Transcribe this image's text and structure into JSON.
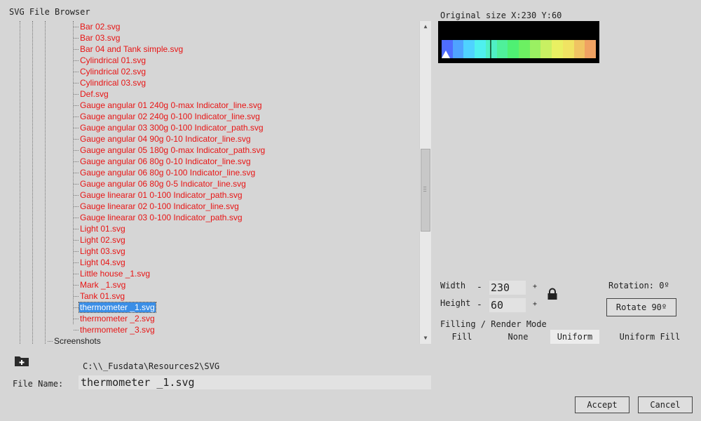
{
  "window": {
    "title": "SVG File Browser"
  },
  "tree": {
    "files": [
      "Bar 02.svg",
      "Bar 03.svg",
      "Bar 04 and Tank simple.svg",
      "Cylindrical 01.svg",
      "Cylindrical 02.svg",
      "Cylindrical 03.svg",
      "Def.svg",
      "Gauge angular 01 240g 0-max Indicator_line.svg",
      "Gauge angular 02 240g 0-100 Indicator_line.svg",
      "Gauge angular 03 300g 0-100 Indicator_path.svg",
      "Gauge angular 04 90g 0-10 Indicator_line.svg",
      "Gauge angular 05 180g 0-max Indicator_path.svg",
      "Gauge angular 06 80g 0-10 Indicator_line.svg",
      "Gauge angular 06 80g 0-100 Indicator_line.svg",
      "Gauge angular 06 80g 0-5 Indicator_line.svg",
      "Gauge linearar 01 0-100 Indicator_path.svg",
      "Gauge linearar 02 0-100 Indicator_line.svg",
      "Gauge linearar 03 0-100 Indicator_path.svg",
      "Light 01.svg",
      "Light 02.svg",
      "Light 03.svg",
      "Light 04.svg",
      "Little house _1.svg",
      "Mark _1.svg",
      "Tank 01.svg",
      "thermometer _1.svg",
      "thermometer _2.svg",
      "thermometer _3.svg"
    ],
    "selected_file": "thermometer _1.svg",
    "folder": "Screenshots"
  },
  "preview": {
    "size_text": "Original size X:230 Y:60",
    "bar_colors": [
      "#4f6dff",
      "#4fa3ff",
      "#4fd2ff",
      "#4ff0ee",
      "#4ff0c4",
      "#4ff09a",
      "#4ff073",
      "#6cf062",
      "#9af062",
      "#c8f062",
      "#e9f062",
      "#f0e362",
      "#f0c462",
      "#f0a262"
    ]
  },
  "controls": {
    "width_label": "Width",
    "width_value": "230",
    "height_label": "Height",
    "height_value": "60",
    "minus": "-",
    "plus": "+",
    "rotation_text": "Rotation: 0º",
    "rotate_button": "Rotate 90º",
    "mode_title": "Filling / Render Mode",
    "modes": [
      "Fill",
      "None",
      "Uniform",
      "Uniform Fill"
    ],
    "active_mode": "Uniform"
  },
  "footer": {
    "path": "C:\\\\_Fusdata\\Resources2\\SVG",
    "filename_label": "File Name:",
    "filename_value": "thermometer _1.svg",
    "accept": "Accept",
    "cancel": "Cancel"
  }
}
